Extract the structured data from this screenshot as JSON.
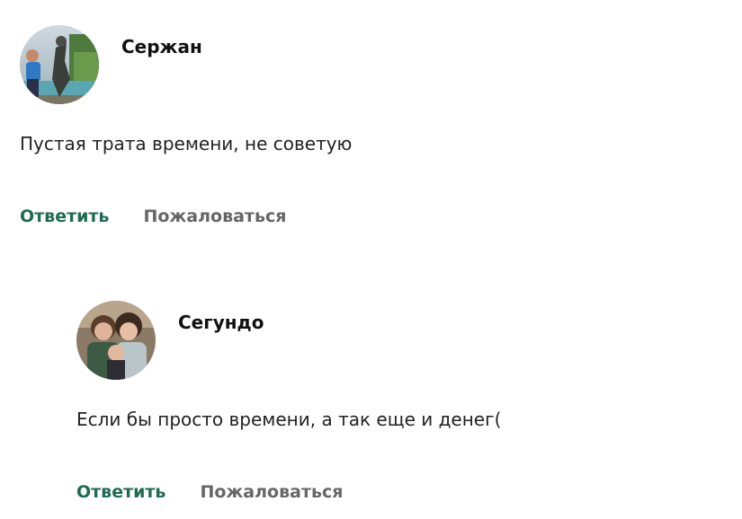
{
  "comments": [
    {
      "author": "Сержан",
      "text": "Пустая трата времени, не советую",
      "reply_label": "Ответить",
      "report_label": "Пожаловаться"
    },
    {
      "author": "Сегундо",
      "text": "Если бы просто времени, а так еще и денег(",
      "reply_label": "Ответить",
      "report_label": "Пожаловаться"
    }
  ],
  "colors": {
    "reply_link": "#1e6b50",
    "report_link": "#666666"
  }
}
